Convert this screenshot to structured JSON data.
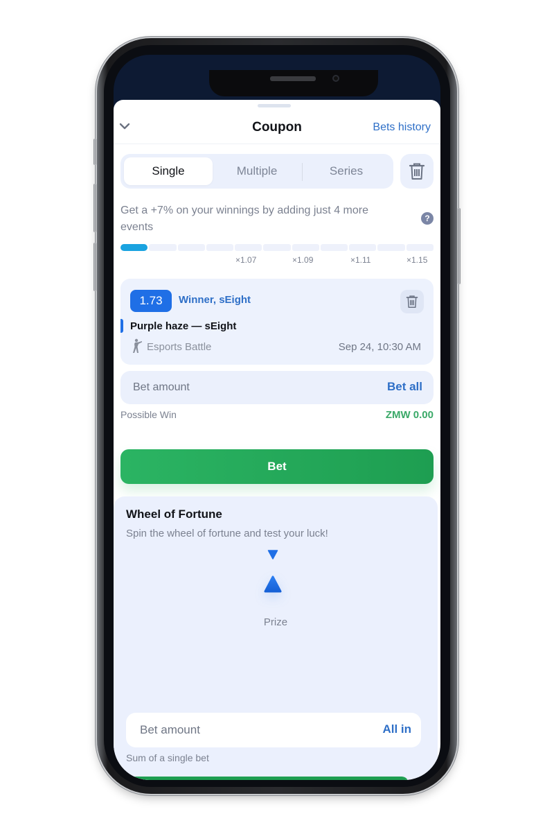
{
  "header": {
    "title": "Coupon",
    "bets_history": "Bets history"
  },
  "tabs": [
    {
      "label": "Single",
      "active": true
    },
    {
      "label": "Multiple",
      "active": false
    },
    {
      "label": "Series",
      "active": false
    }
  ],
  "promo": {
    "text": "Get a +7% on your winnings by adding just 4 more events",
    "progress_filled_segments": 1,
    "progress_total_segments": 11,
    "multipliers": [
      "×1.07",
      "×1.09",
      "×1.11",
      "×1.15"
    ]
  },
  "bet": {
    "odds": "1.73",
    "market": "Winner, sEight",
    "match": "Purple haze — sEight",
    "sport": "Esports Battle",
    "date": "Sep 24, 10:30 AM"
  },
  "stake": {
    "placeholder": "Bet amount",
    "bet_all": "Bet all",
    "possible_win_label": "Possible Win",
    "possible_win_value": "ZMW 0.00"
  },
  "bet_button": "Bet",
  "wheel": {
    "title": "Wheel of Fortune",
    "subtitle": "Spin the wheel of fortune and test your luck!",
    "prize_label": "Prize",
    "amount_placeholder": "Bet amount",
    "all_in": "All in",
    "hint": "Sum of a single bet"
  },
  "colors": {
    "accent_blue": "#1f6fe6",
    "link_blue": "#2e6fc7",
    "success_green": "#2bb463",
    "progress_blue": "#1aa3e0"
  }
}
